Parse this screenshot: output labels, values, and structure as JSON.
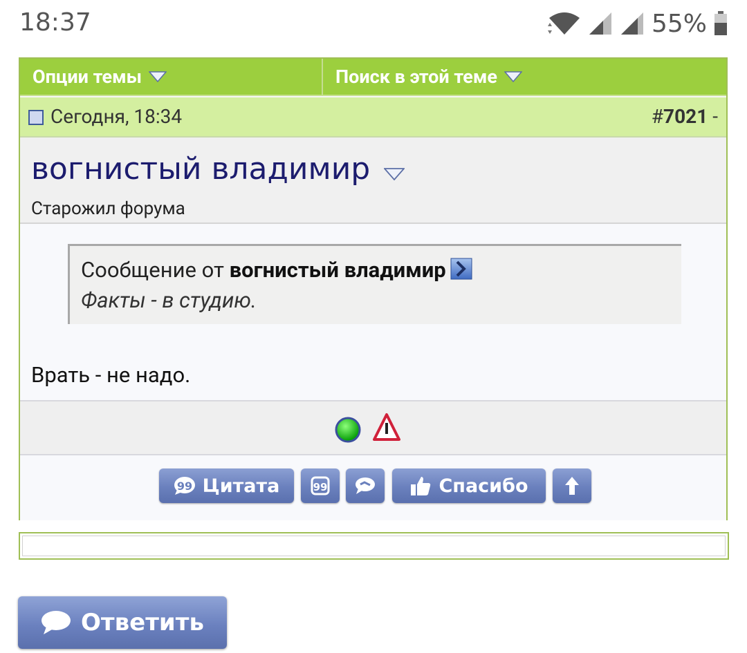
{
  "status_bar": {
    "time": "18:37",
    "battery": "55%"
  },
  "thread_tools": {
    "options_label": "Опции темы",
    "search_label": "Поиск в этой теме"
  },
  "post": {
    "date": "Сегодня, 18:34",
    "number_prefix": "#",
    "number": "7021",
    "number_suffix": " -",
    "username": "вогнистый владимир",
    "user_title": "Старожил форума",
    "quote": {
      "prefix": "Сообщение от ",
      "author": "вогнистый владимир",
      "text": "Факты - в студию."
    },
    "message": "Врать - не надо."
  },
  "buttons": {
    "quote": "Цитата",
    "thanks": "Спасибо",
    "reply": "Ответить"
  },
  "colors": {
    "header_green": "#9ccf3e",
    "date_bar_green": "#d4efa0",
    "username_blue": "#1c1c6e",
    "button_blue": "#6a80bd",
    "online_green": "#22cc22",
    "report_red": "#d0213a"
  },
  "icons": {
    "wifi": "wifi-icon",
    "signal": "signal-icon",
    "battery": "battery-icon",
    "dropdown": "triangle-down-icon",
    "post_doc": "document-icon",
    "view_post": "arrow-right-icon",
    "online": "online-status-icon",
    "report": "warning-icon",
    "quote": "speech-bubble-icon",
    "multiquote": "multiquote-icon",
    "quick_reply": "quick-reply-icon",
    "thanks": "thumbs-up-icon",
    "top": "arrow-up-icon"
  }
}
